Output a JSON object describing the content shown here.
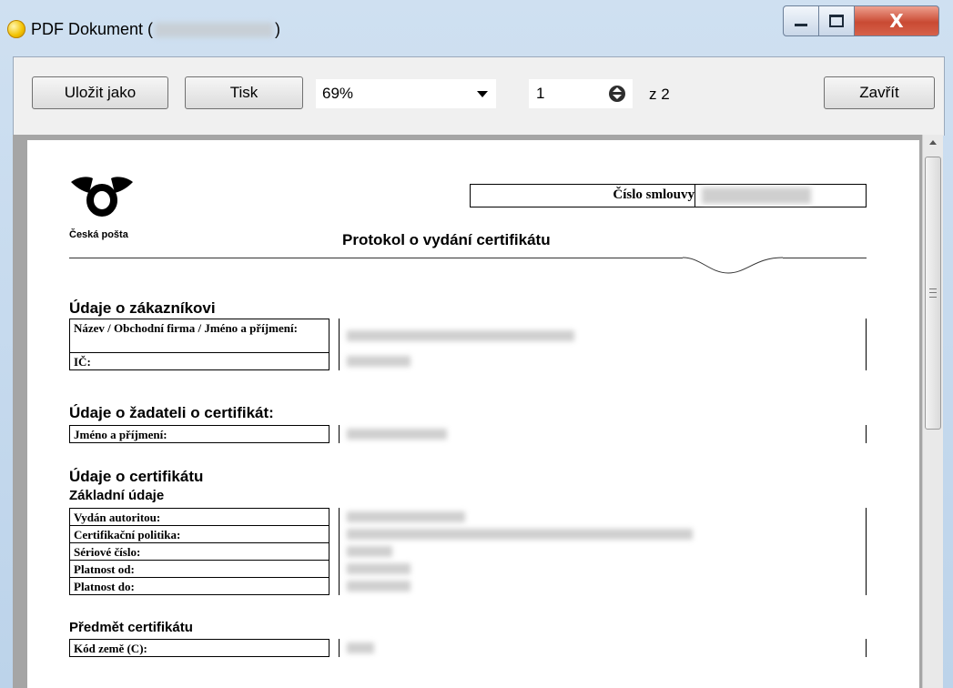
{
  "window": {
    "title": "PDF Dokument (",
    "title_close_paren": ")",
    "close_glyph": "X"
  },
  "toolbar": {
    "save_as_label": "Uložit jako",
    "print_label": "Tisk",
    "zoom_value": "69%",
    "page_current": "1",
    "page_of": "z 2",
    "close_label": "Zavřít"
  },
  "document": {
    "logo_text": "Česká pošta",
    "contract_number_label": "Číslo smlouvy",
    "title": "Protokol o vydání certifikátu",
    "customer_section": "Údaje o zákazníkovi",
    "customer_name_label": "Název / Obchodní firma / Jméno a příjmení:",
    "customer_ic_label": "IČ:",
    "applicant_section": "Údaje o žadateli o certifikát:",
    "applicant_name_label": "Jméno a příjmení:",
    "certificate_section": "Údaje o certifikátu",
    "basic_subsection": "Základní údaje",
    "issued_by_label": "Vydán autoritou:",
    "policy_label": "Certifikační politika:",
    "serial_label": "Sériové číslo:",
    "valid_from_label": "Platnost od:",
    "valid_to_label": "Platnost do:",
    "subject_subsection": "Předmět certifikátu",
    "country_code_label": "Kód země (C):"
  }
}
